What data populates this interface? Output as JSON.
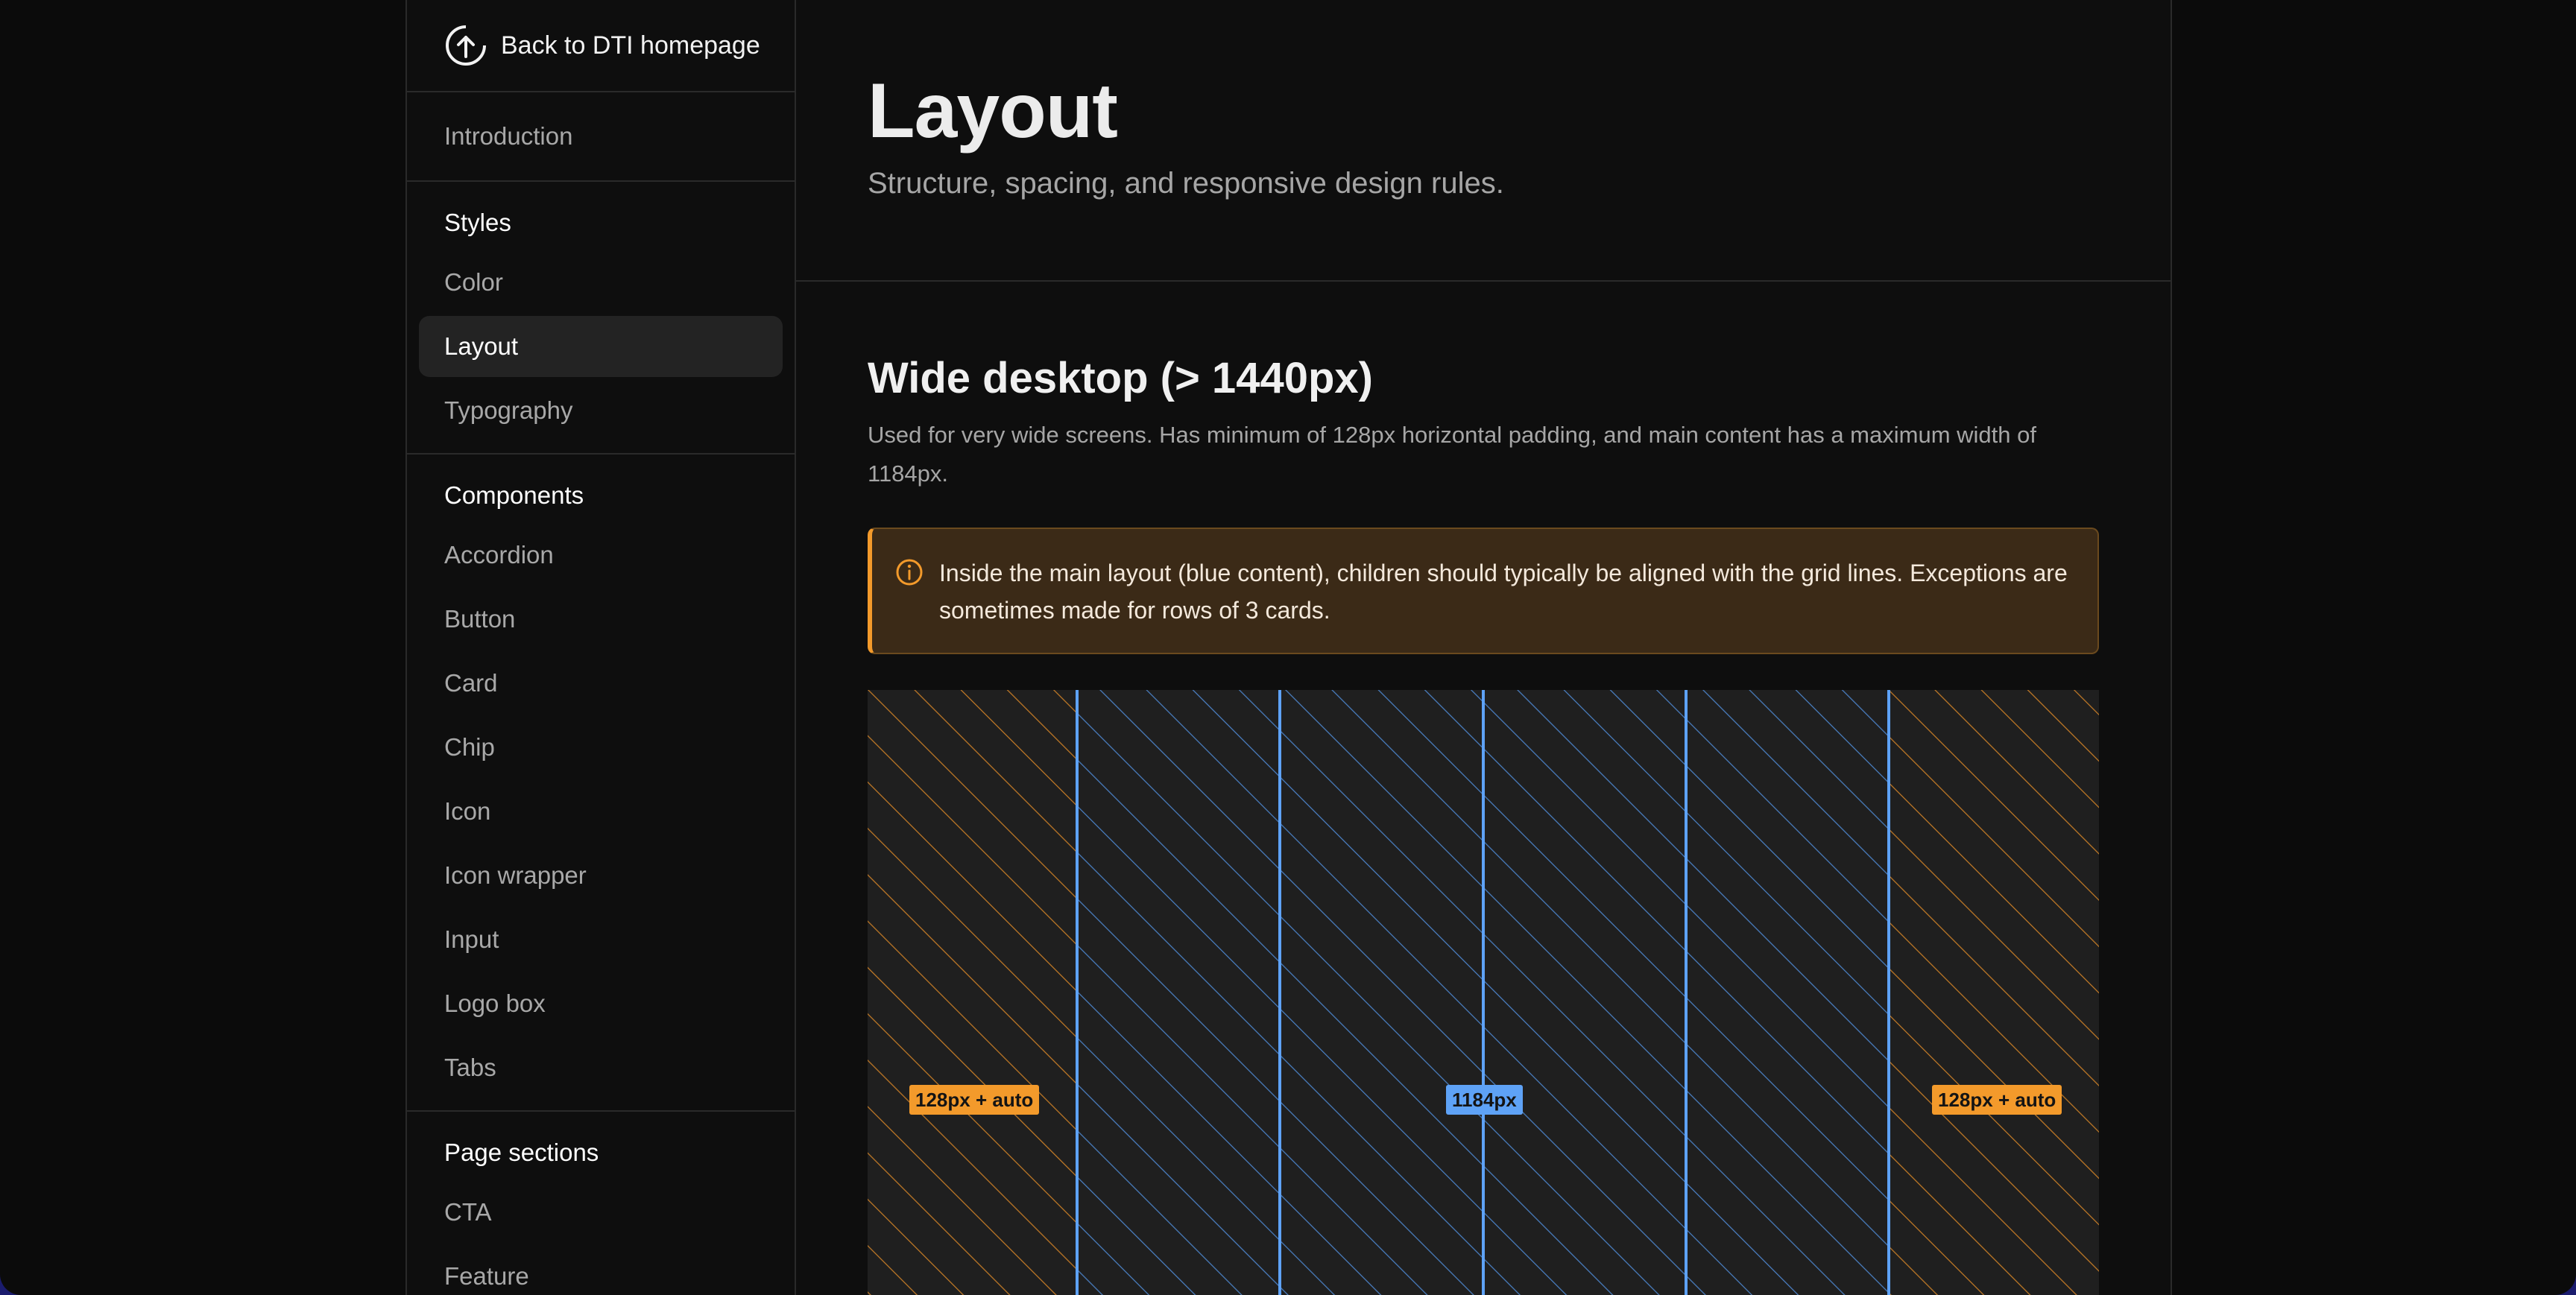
{
  "sidebar": {
    "back_label": "Back to DTI homepage",
    "intro": "Introduction",
    "sections": [
      {
        "heading": "Styles",
        "items": [
          "Color",
          "Layout",
          "Typography"
        ],
        "active": "Layout"
      },
      {
        "heading": "Components",
        "items": [
          "Accordion",
          "Button",
          "Card",
          "Chip",
          "Icon",
          "Icon wrapper",
          "Input",
          "Logo box",
          "Tabs"
        ]
      },
      {
        "heading": "Page sections",
        "items": [
          "CTA",
          "Feature"
        ]
      }
    ]
  },
  "hero": {
    "title": "Layout",
    "subtitle": "Structure, spacing, and responsive design rules."
  },
  "section": {
    "title": "Wide desktop (> 1440px)",
    "description": "Used for very wide screens. Has minimum of 128px horizontal padding, and main content has a maximum width of 1184px.",
    "callout": "Inside the main layout (blue content), children should typically be aligned with the grid lines. Exceptions are sometimes made for rows of 3 cards."
  },
  "grid_demo": {
    "left_label": "128px + auto",
    "center_label": "1184px",
    "right_label": "128px + auto",
    "columns": 4
  },
  "colors": {
    "accent_orange": "#f39a2b",
    "accent_blue": "#5ea2f6",
    "callout_bg": "#3b2a17"
  }
}
